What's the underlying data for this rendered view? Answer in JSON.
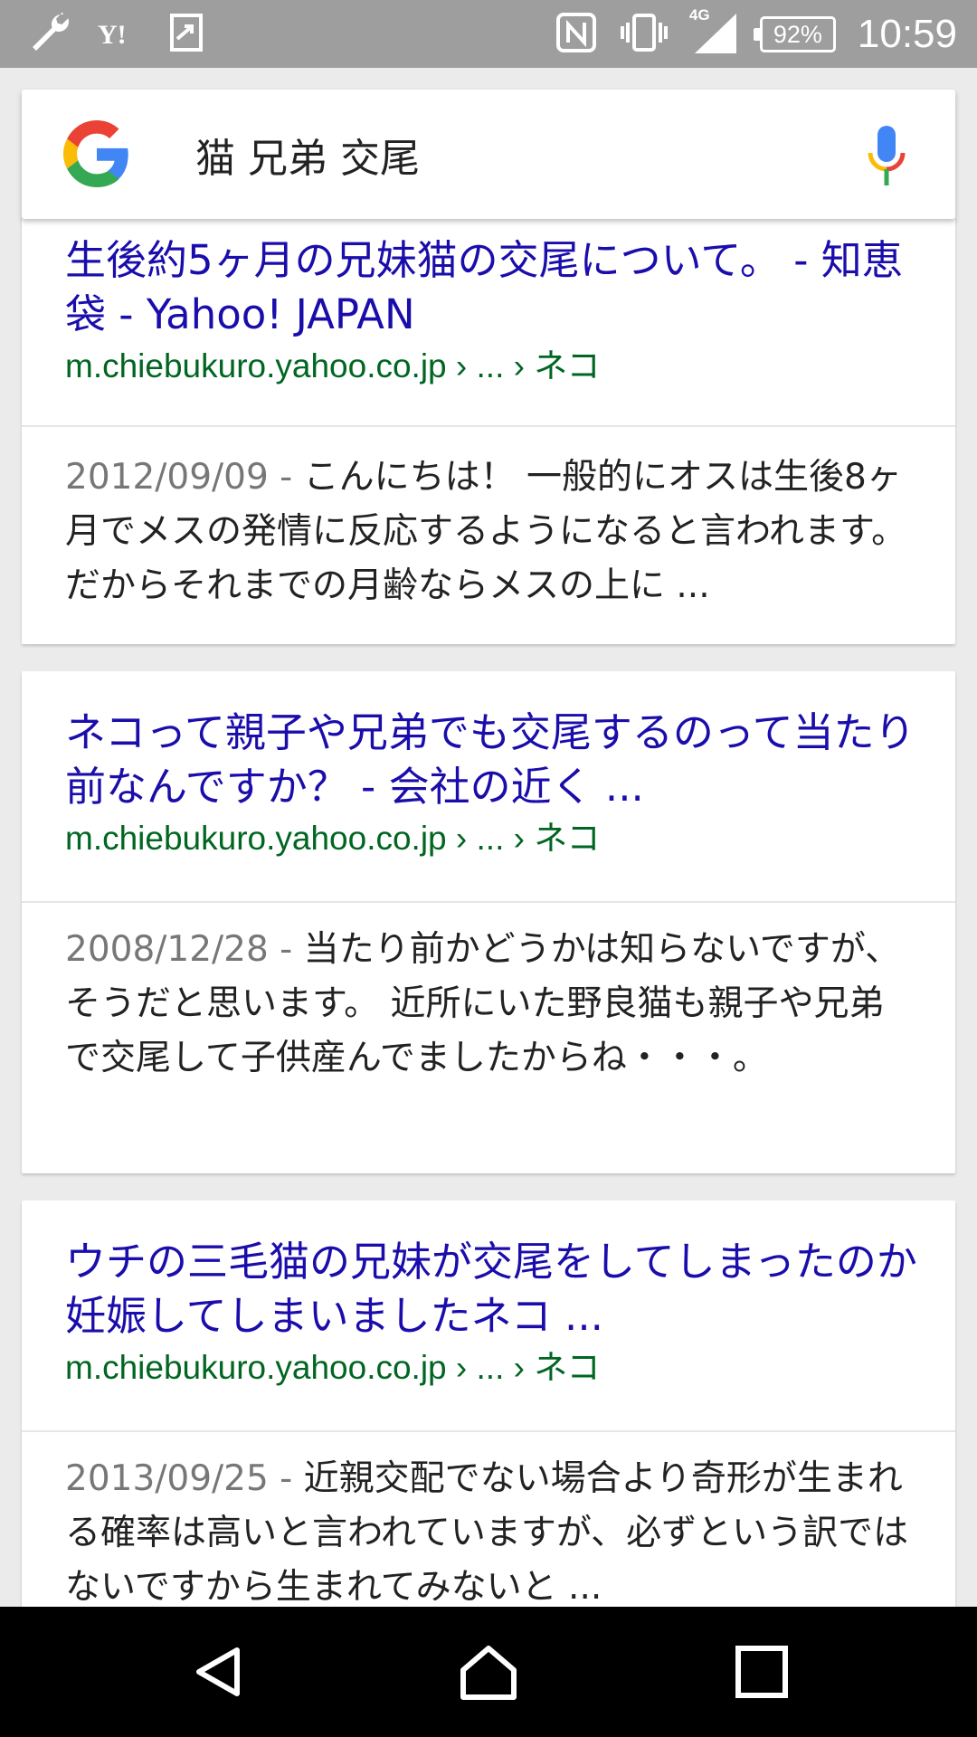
{
  "status_bar": {
    "left_icons": [
      "wrench-icon",
      "yahoo-icon",
      "share-icon"
    ],
    "right_icons": [
      "nfc-icon",
      "vibrate-icon",
      "signal-icon",
      "battery-icon"
    ],
    "network": "4G",
    "battery": "92%",
    "time": "10:59"
  },
  "search": {
    "query": "猫 兄弟 交尾",
    "logo": "google-logo",
    "mic": "microphone-icon"
  },
  "results": [
    {
      "title": "生後約5ヶ月の兄妹猫の交尾について。 - 知恵袋 - Yahoo! JAPAN",
      "url": "m.chiebukuro.yahoo.co.jp › ... › ネコ",
      "date": "2012/09/09 - ",
      "snippet": "こんにちは！ 一般的にオスは生後8ヶ月でメスの発情に反応するようになると言われます。 だからそれまでの月齢ならメスの上に ..."
    },
    {
      "title": "ネコって親子や兄弟でも交尾するのって当たり前なんですか？ - 会社の近く ...",
      "url": "m.chiebukuro.yahoo.co.jp › ... › ネコ",
      "date": "2008/12/28 - ",
      "snippet": "当たり前かどうかは知らないですが、そうだと思います。 近所にいた野良猫も親子や兄弟で交尾して子供産んでましたからね・・・。"
    },
    {
      "title": "ウチの三毛猫の兄妹が交尾をしてしまったのか妊娠してしまいましたネコ ...",
      "url": "m.chiebukuro.yahoo.co.jp › ... › ネコ",
      "date": "2013/09/25 - ",
      "snippet": "近親交配でない場合より奇形が生まれる確率は高いと言われていますが、必ずという訳ではないですから生まれてみないと ..."
    }
  ],
  "nav_bar": {
    "buttons": [
      "back-icon",
      "home-icon",
      "recents-icon"
    ]
  },
  "colors": {
    "status_bar": "#9e9e9e",
    "title_link": "#1a0dab",
    "url": "#006621",
    "background": "#ebebeb"
  }
}
